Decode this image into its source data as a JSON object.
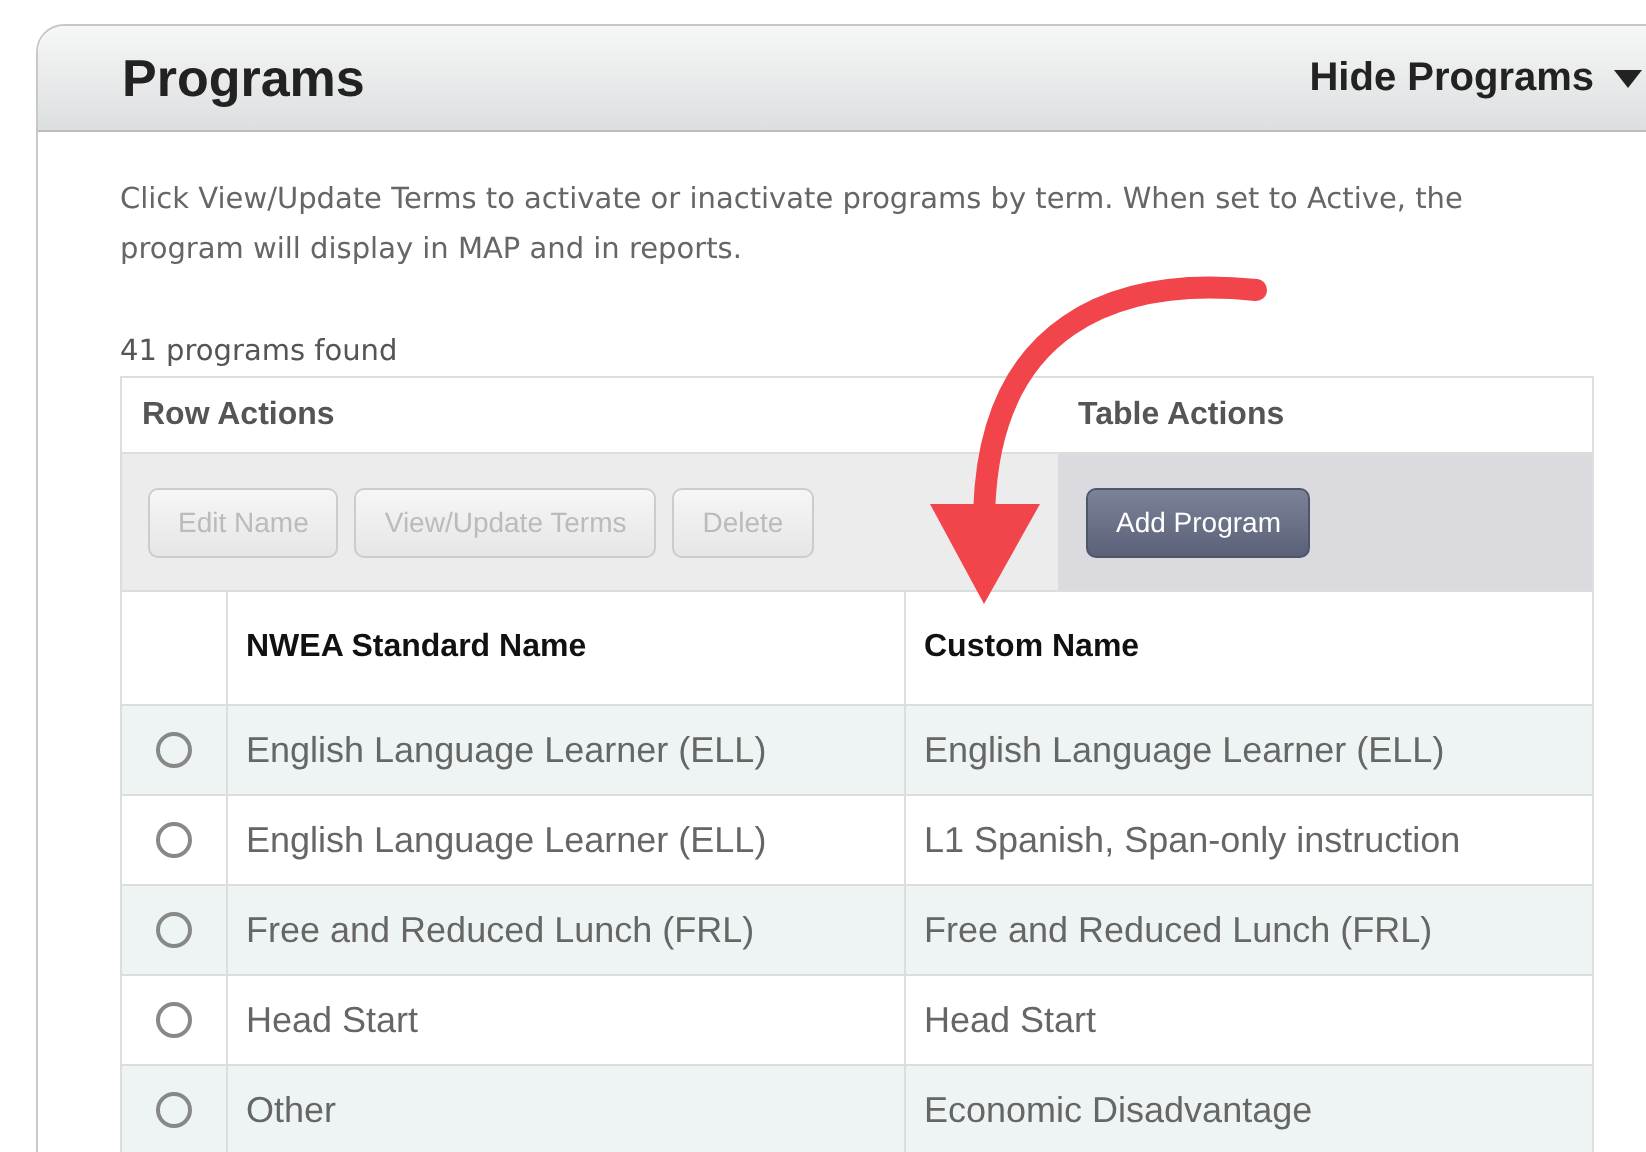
{
  "panel": {
    "title": "Programs",
    "toggle": {
      "label": "Hide Programs",
      "expanded": true
    }
  },
  "description": "Click View/Update Terms to activate or inactivate programs by term. When set to Active, the program will display in MAP and in reports.",
  "count": "41 programs found",
  "row_actions": {
    "heading": "Row Actions",
    "buttons": [
      {
        "label": "Edit Name",
        "disabled": true
      },
      {
        "label": "View/Update Terms",
        "disabled": true
      },
      {
        "label": "Delete",
        "disabled": true
      }
    ]
  },
  "table_actions": {
    "heading": "Table Actions",
    "buttons": [
      {
        "label": "Add Program",
        "disabled": false
      }
    ]
  },
  "table": {
    "columns": [
      "NWEA Standard Name",
      "Custom Name"
    ],
    "rows": [
      {
        "selected": false,
        "cells": [
          "English Language Learner (ELL)",
          "English Language Learner (ELL)"
        ]
      },
      {
        "selected": false,
        "cells": [
          "English Language Learner (ELL)",
          "L1 Spanish, Span-only instruction"
        ]
      },
      {
        "selected": false,
        "cells": [
          "Free and Reduced Lunch (FRL)",
          "Free and Reduced Lunch (FRL)"
        ]
      },
      {
        "selected": false,
        "cells": [
          "Head Start",
          "Head Start"
        ]
      },
      {
        "selected": false,
        "cells": [
          "Other",
          "Economic Disadvantage"
        ]
      }
    ]
  }
}
